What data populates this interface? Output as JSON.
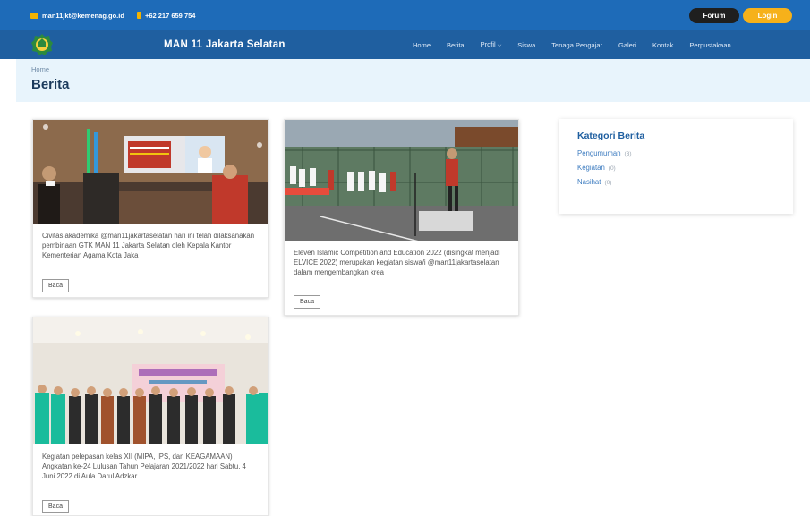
{
  "topbar": {
    "email": "man11jkt@kemenag.go.id",
    "phone": "+62 217 659 754",
    "forum_label": "Forum",
    "login_label": "Login"
  },
  "nav": {
    "brand": "MAN 11 Jakarta Selatan",
    "items": [
      "Home",
      "Berita",
      "Profil",
      "Siswa",
      "Tenaga Pengajar",
      "Galeri",
      "Kontak",
      "Perpustakaan"
    ]
  },
  "page": {
    "breadcrumb": "Home",
    "title": "Berita"
  },
  "posts": [
    {
      "text": "Civitas akademika @man11jakartaselatan hari ini telah dilaksanakan pembinaan GTK MAN 11 Jakarta Selatan oleh Kepala Kantor Kementerian Agama Kota Jaka",
      "button": "Baca"
    },
    {
      "text": "Eleven Islamic Competition and Education 2022 (disingkat menjadi ELVICE 2022) merupakan kegiatan siswa/i @man11jakartaselatan dalam mengembangkan krea",
      "button": "Baca"
    },
    {
      "text": "Kegiatan pelepasan kelas XII (MIPA, IPS, dan KEAGAMAAN) Angkatan ke-24 Lulusan Tahun Pelajaran 2021/2022 hari Sabtu, 4 Juni 2022 di Aula Darul Adzkar",
      "button": "Baca"
    }
  ],
  "sidebar": {
    "title": "Kategori Berita",
    "categories": [
      {
        "name": "Pengumuman",
        "count": "(3)"
      },
      {
        "name": "Kegiatan",
        "count": "(0)"
      },
      {
        "name": "Nasihat",
        "count": "(0)"
      }
    ]
  },
  "colors": {
    "topbar": "#1e6bb8",
    "navbar": "#1f5fa0",
    "login": "#f6b11a",
    "forum": "#1f1f1f",
    "header_bg": "#e8f4fc"
  }
}
